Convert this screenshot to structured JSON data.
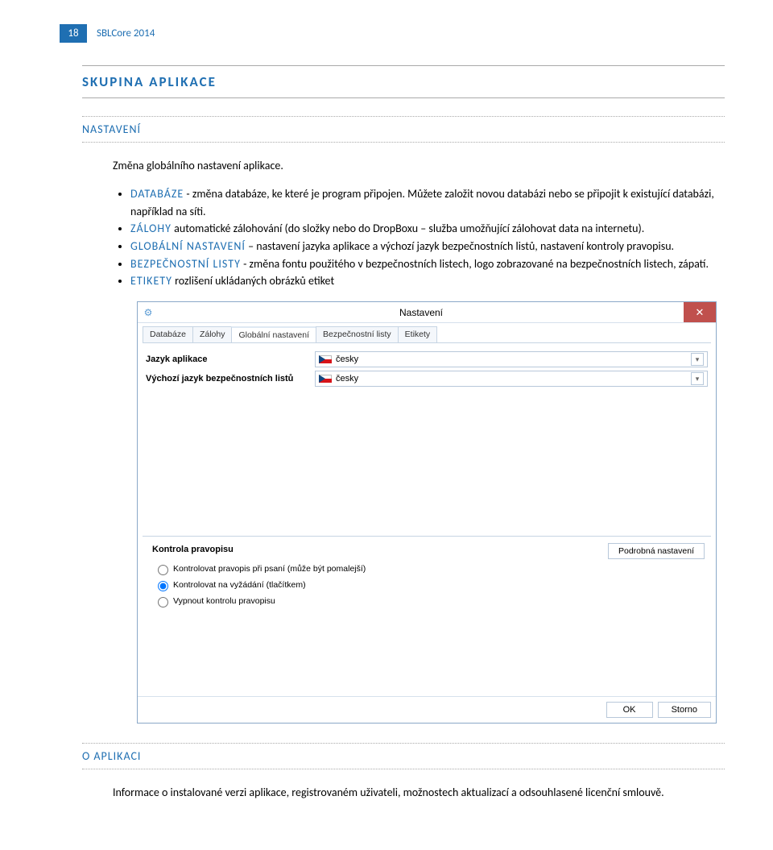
{
  "header": {
    "page_number": "18",
    "doc_title": "SBLCore 2014"
  },
  "section_title": "SKUPINA APLIKACE",
  "section_settings_title": "NASTAVENÍ",
  "section_settings_intro": "Změna globálního nastavení aplikace.",
  "bullets": {
    "db_kw": "DATABÁZE",
    "db_text": " - změna databáze, ke které je program připojen. Můžete založit novou databázi nebo se připojit k existující databázi, například na síti.",
    "backup_kw": "ZÁLOHY",
    "backup_text": " automatické zálohování (do složky nebo do DropBoxu – služba umožňující zálohovat data na internetu).",
    "global_kw": "GLOBÁLNÍ NASTAVENÍ",
    "global_text": " – nastavení jazyka aplikace a výchozí jazyk bezpečnostních listů, nastavení kontroly pravopisu.",
    "bls_kw": "BEZPEČNOSTNÍ LISTY",
    "bls_text": " - změna fontu použitého v bezpečnostních listech, logo zobrazované na bezpečnostních listech, zápatí.",
    "labels_kw": "ETIKETY",
    "labels_text": " rozlišení ukládaných obrázků etiket"
  },
  "dialog": {
    "title": "Nastavení",
    "close_glyph": "✕",
    "tabs": [
      "Databáze",
      "Zálohy",
      "Globální nastavení",
      "Bezpečnostní listy",
      "Etikety"
    ],
    "active_tab_index": 2,
    "form": {
      "lang_app_label": "Jazyk aplikace",
      "lang_app_value": "česky",
      "lang_bls_label": "Výchozí jazyk bezpečnostních listů",
      "lang_bls_value": "česky"
    },
    "fieldset_title": "Kontrola pravopisu",
    "radios": [
      "Kontrolovat pravopis při psaní (může být pomalejší)",
      "Kontrolovat na vyžádání (tlačítkem)",
      "Vypnout kontrolu pravopisu"
    ],
    "details_button": "Podrobná nastavení",
    "ok": "OK",
    "cancel": "Storno"
  },
  "section_about_title": "O APLIKACI",
  "about_text": "Informace o instalované verzi aplikace, registrovaném uživateli, možnostech aktualizací a odsouhlasené licenční smlouvě."
}
